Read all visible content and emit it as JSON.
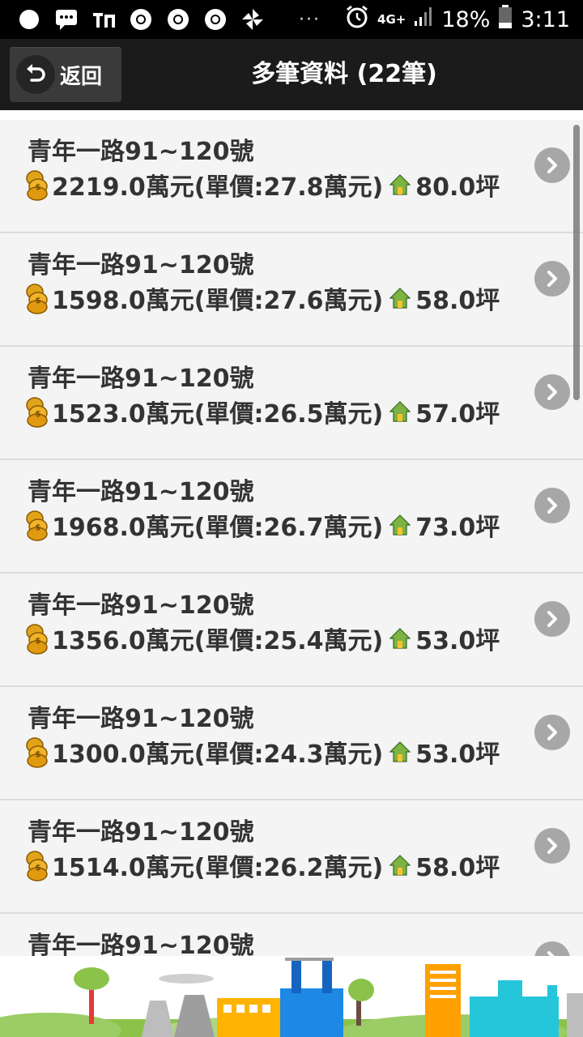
{
  "status_bar": {
    "network": "4G+",
    "battery": "18%",
    "time": "3:11"
  },
  "action_bar": {
    "back_label": "返回",
    "title": "多筆資料 (22筆)"
  },
  "list": {
    "items": [
      {
        "address": "青年一路91~120號",
        "price": "2219.0萬元(單價:27.8萬元)",
        "area": "80.0坪"
      },
      {
        "address": "青年一路91~120號",
        "price": "1598.0萬元(單價:27.6萬元)",
        "area": "58.0坪"
      },
      {
        "address": "青年一路91~120號",
        "price": "1523.0萬元(單價:26.5萬元)",
        "area": "57.0坪"
      },
      {
        "address": "青年一路91~120號",
        "price": "1968.0萬元(單價:26.7萬元)",
        "area": "73.0坪"
      },
      {
        "address": "青年一路91~120號",
        "price": "1356.0萬元(單價:25.4萬元)",
        "area": "53.0坪"
      },
      {
        "address": "青年一路91~120號",
        "price": "1300.0萬元(單價:24.3萬元)",
        "area": "53.0坪"
      },
      {
        "address": "青年一路91~120號",
        "price": "1514.0萬元(單價:26.2萬元)",
        "area": "58.0坪"
      },
      {
        "address": "青年一路91~120號",
        "price": "",
        "area": ""
      }
    ]
  },
  "colors": {
    "statusbar_bg": "#000000",
    "actionbar_bg": "#1b1b1b",
    "list_bg": "#f4f4f4",
    "chevron_bg": "#a7a7a7",
    "text": "#333333"
  },
  "icons": [
    "coin-stack-icon",
    "house-icon",
    "chevron-right-icon",
    "back-arrow-icon"
  ]
}
